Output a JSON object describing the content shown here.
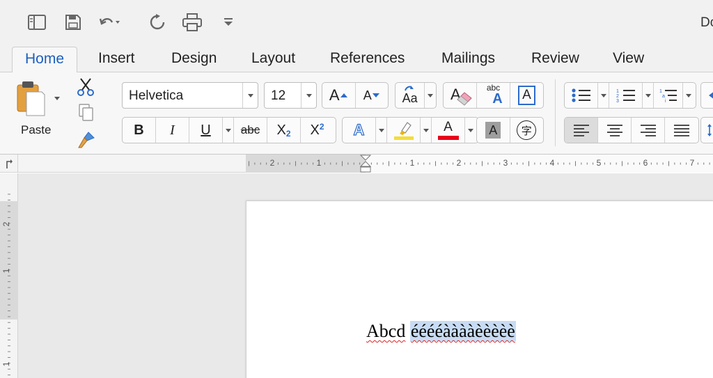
{
  "window": {
    "title": "Do"
  },
  "quick_access": [
    {
      "name": "sidebar-icon"
    },
    {
      "name": "save-icon"
    },
    {
      "name": "undo-icon"
    },
    {
      "name": "redo-icon"
    },
    {
      "name": "print-icon"
    },
    {
      "name": "customize-icon"
    }
  ],
  "tabs": [
    "Home",
    "Insert",
    "Design",
    "Layout",
    "References",
    "Mailings",
    "Review",
    "View"
  ],
  "active_tab": "Home",
  "clipboard": {
    "paste_label": "Paste"
  },
  "font": {
    "name": "Helvetica",
    "size": "12",
    "subscript_label": "X",
    "subscript_index": "2",
    "superscript_label": "X",
    "superscript_index": "2",
    "bold_label": "B",
    "italic_label": "I",
    "underline_label": "U",
    "strike_label": "abc",
    "grow_label": "A",
    "shrink_label": "A",
    "case_label": "Aa",
    "clear_label": "A",
    "phonetic_label": "abc",
    "phonetic_sub": "A",
    "border_label": "A",
    "effects_label": "A",
    "color_label": "A",
    "shading_label": "A",
    "enclose_label": "字"
  },
  "colors": {
    "font_color": "#e8001c",
    "highlight": "#f4dc3a",
    "accent": "#1d5fbf",
    "selection": "#c7dcf4"
  },
  "ruler": {
    "h_numbers": [
      "2",
      "1",
      "1",
      "2",
      "3",
      "4",
      "5",
      "6",
      "7"
    ],
    "v_numbers": [
      "2",
      "1",
      "1"
    ]
  },
  "document": {
    "word1": "Abcd",
    "word2": "ééééààààèèèèè"
  }
}
